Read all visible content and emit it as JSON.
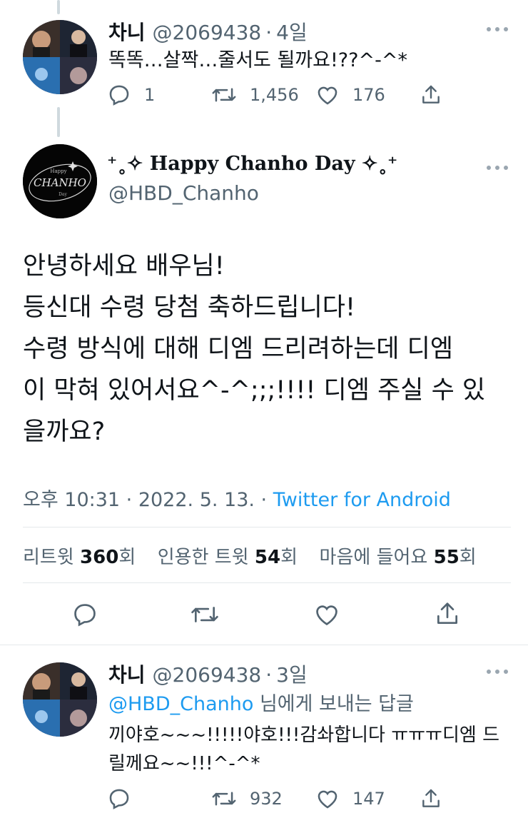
{
  "reply1": {
    "name": "차니",
    "handle": "@2069438",
    "sep": "·",
    "time": "4일",
    "text": "똑똑…살짝…줄서도 될까요!??^-^*",
    "replies": "1",
    "retweets": "1,456",
    "likes": "176"
  },
  "main": {
    "name": "⁺˳✧ Happy Chanho Day ✧˳⁺",
    "handle": "@HBD_Chanho",
    "avatar_text": "CHANHO",
    "avatar_small_top": "Happy",
    "avatar_small_bottom": "Day",
    "lines": [
      "안녕하세요 배우님!",
      "등신대 수령 당첨 축하드립니다!",
      "수령 방식에 대해 디엠 드리려하는데 디엠",
      "이 막혀 있어서요^-^;;;!!!! 디엠 주실 수 있",
      "을까요?"
    ],
    "timestamp": "오후 10:31 · 2022. 5. 13. · ",
    "source": "Twitter for Android",
    "stats": {
      "retweet_label": "리트윗 ",
      "retweet_count": "360",
      "retweet_unit": "회",
      "quote_label": "인용한 트윗 ",
      "quote_count": "54",
      "quote_unit": "회",
      "like_label": "마음에 들어요 ",
      "like_count": "55",
      "like_unit": "회"
    }
  },
  "reply2": {
    "name": "차니",
    "handle": "@2069438",
    "sep": "·",
    "time": "3일",
    "reply_to_handle": "@HBD_Chanho",
    "reply_to_suffix": " 님에게 보내는 답글",
    "text_line1": "끼야호~~~!!!!!야호!!!감솨합니다 ㅠㅠㅠ디엠 드",
    "text_line2": "릴께요~~!!!^-^*",
    "retweets": "932",
    "likes": "147"
  },
  "colors": {
    "accent": "#1d9bf0",
    "text": "#0f1419",
    "secondary": "#536471",
    "line": "#cfd9de"
  }
}
